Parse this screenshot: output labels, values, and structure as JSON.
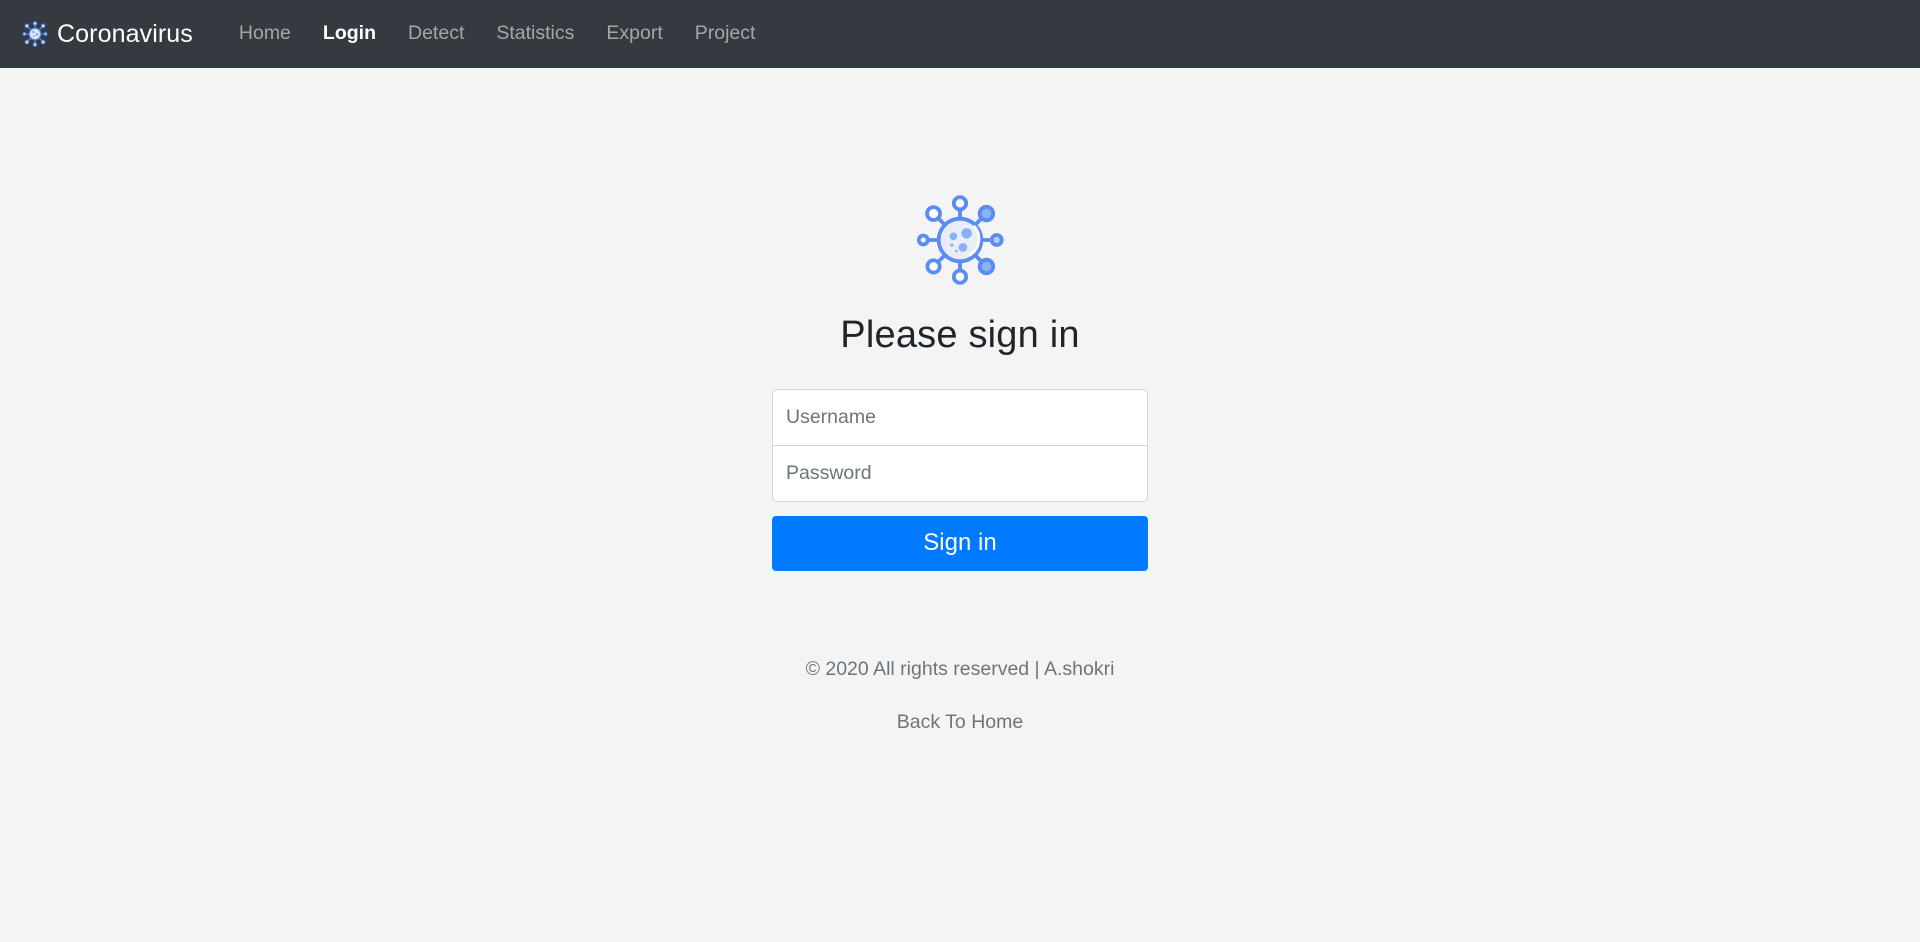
{
  "navbar": {
    "brand": {
      "label": "Coronavirus",
      "icon": "virus-icon"
    },
    "links": [
      {
        "label": "Home",
        "active": false
      },
      {
        "label": "Login",
        "active": true
      },
      {
        "label": "Detect",
        "active": false
      },
      {
        "label": "Statistics",
        "active": false
      },
      {
        "label": "Export",
        "active": false
      },
      {
        "label": "Project",
        "active": false
      }
    ],
    "background_color": "#343a40",
    "active_link_color": "#ffffff",
    "inactive_link_color": "rgba(255,255,255,0.55)"
  },
  "main": {
    "hero_icon": "virus-icon",
    "heading": "Please sign in",
    "form": {
      "username": {
        "placeholder": "Username",
        "value": ""
      },
      "password": {
        "placeholder": "Password",
        "value": ""
      },
      "submit_label": "Sign in"
    }
  },
  "footer": {
    "copyright": "© 2020 All rights reserved | A.shokri",
    "back_link": "Back To Home"
  },
  "colors": {
    "page_background": "#f4f4f4",
    "primary": "#007bff",
    "muted_text": "#6c757d",
    "heading_text": "#212529",
    "input_border": "#ced4da",
    "virus_stroke": "#4a80f0",
    "virus_fill": "#e9edf8",
    "virus_accent": "#8ab0f5"
  }
}
